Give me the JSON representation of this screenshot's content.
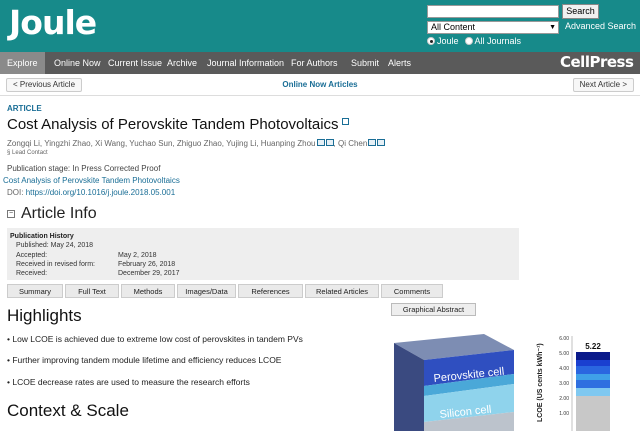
{
  "header": {
    "logo": "Joule",
    "search_placeholder": "",
    "search_button": "Search",
    "scope_selected": "All Content",
    "advanced_search": "Advanced Search",
    "radio_joule": "Joule",
    "radio_all": "All Journals",
    "brand_color": "#178a8a"
  },
  "nav": {
    "items": [
      "Explore",
      "Online Now",
      "Current Issue",
      "Archive",
      "Journal Information",
      "For Authors",
      "Submit",
      "Alerts"
    ],
    "publisher": "CellPress"
  },
  "pager": {
    "prev": "< Previous Article",
    "center": "Online Now Articles",
    "next": "Next Article >"
  },
  "article": {
    "label": "ARTICLE",
    "title": "Cost Analysis of Perovskite Tandem Photovoltaics",
    "authors": "Zongqi Li, Yingzhi Zhao, Xi Wang, Yuchao Sun, Zhiguo Zhao, Yujing Li, Huanping Zhou",
    "last_author": "Qi Chen",
    "lead_contact": "Lead Contact",
    "pub_stage": "Publication stage: In Press Corrected Proof",
    "sub_link": "Cost Analysis of Perovskite Tandem Photovoltaics",
    "doi_label": "DOI:",
    "doi": "https://doi.org/10.1016/j.joule.2018.05.001"
  },
  "article_info": {
    "heading": "Article Info",
    "history_title": "Publication History",
    "history": [
      {
        "label": "Published: May 24, 2018",
        "value": ""
      },
      {
        "label": "Accepted:",
        "value": "May 2, 2018"
      },
      {
        "label": "Received in revised form:",
        "value": "February 26, 2018"
      },
      {
        "label": "Received:",
        "value": "December 29, 2017"
      }
    ]
  },
  "tabs": [
    "Summary",
    "Full Text",
    "Methods",
    "Images/Data",
    "References",
    "Related Articles",
    "Comments"
  ],
  "graphical_abstract": {
    "button": "Graphical Abstract",
    "layer_top": "Perovskite cell",
    "layer_bottom": "Silicon cell",
    "ylabel": "LCOE (US cents kWh⁻¹)",
    "bar_value": "5.22",
    "ticks": [
      "6.00",
      "5.00",
      "4.00",
      "3.00",
      "2.00",
      "1.00"
    ]
  },
  "highlights": {
    "heading": "Highlights",
    "items": [
      "Low LCOE is achieved due to extreme low cost of perovskites in tandem PVs",
      "Further improving tandem module lifetime and efficiency reduces LCOE",
      "LCOE decrease rates are used to measure the research efforts"
    ]
  },
  "context": {
    "heading": "Context & Scale"
  }
}
